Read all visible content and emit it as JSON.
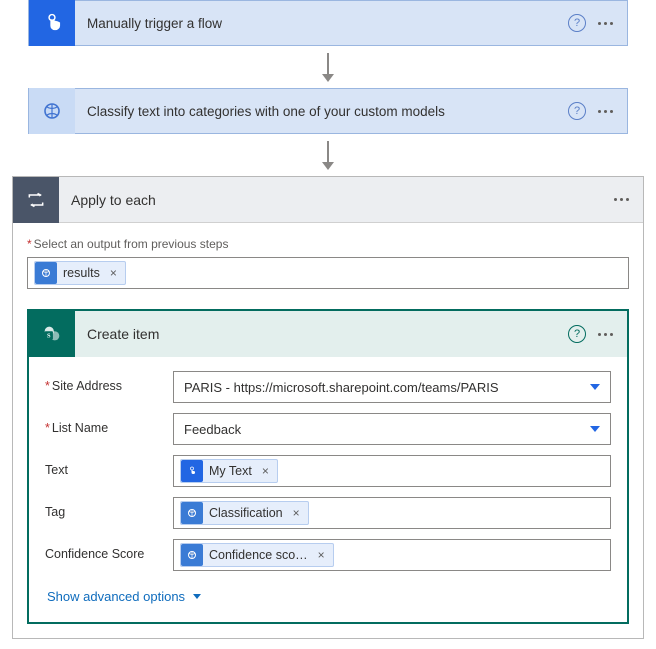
{
  "steps": {
    "trigger": {
      "title": "Manually trigger a flow"
    },
    "classify": {
      "title": "Classify text into categories with one of your custom models"
    },
    "loop": {
      "title": "Apply to each",
      "select_label": "Select an output from previous steps",
      "input_pill": "results"
    },
    "create_item": {
      "title": "Create item",
      "rows": {
        "site_address": {
          "label": "Site Address",
          "value": "PARIS - https://microsoft.sharepoint.com/teams/PARIS"
        },
        "list_name": {
          "label": "List Name",
          "value": "Feedback"
        },
        "text": {
          "label": "Text",
          "pill": "My Text"
        },
        "tag": {
          "label": "Tag",
          "pill": "Classification"
        },
        "confidence": {
          "label": "Confidence Score",
          "pill": "Confidence sco…"
        }
      },
      "advanced": "Show advanced options"
    }
  }
}
